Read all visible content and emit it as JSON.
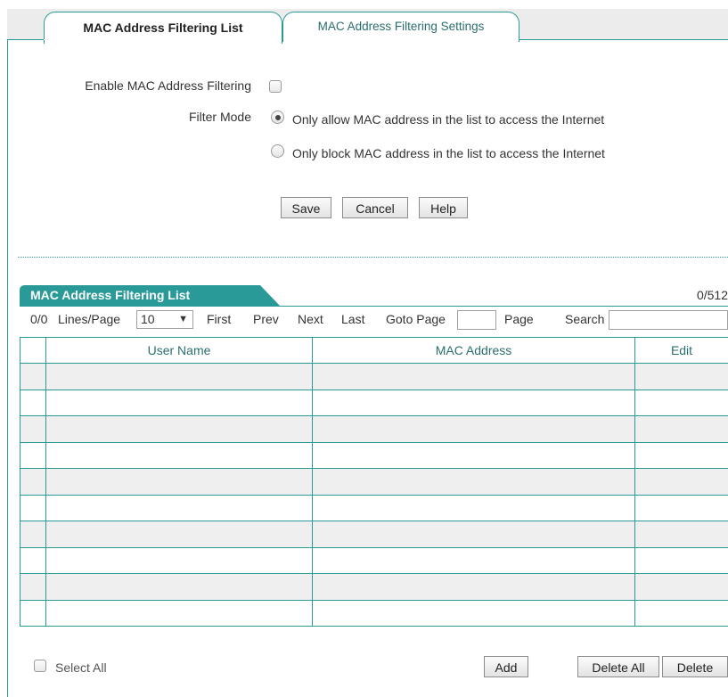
{
  "tabs": {
    "list_tab": "MAC Address Filtering List",
    "settings_tab": "MAC Address Filtering Settings"
  },
  "form": {
    "enable_label": "Enable MAC Address Filtering",
    "enable_checked": false,
    "filter_mode_label": "Filter Mode",
    "mode_allow": "Only allow MAC address in the list to access the Internet",
    "mode_block": "Only block MAC address in the list to access the Internet",
    "selected_mode": "allow"
  },
  "buttons": {
    "save": "Save",
    "cancel": "Cancel",
    "help": "Help",
    "add": "Add",
    "delete_all": "Delete All",
    "delete": "Delete"
  },
  "list": {
    "title": "MAC Address Filtering List",
    "count": "0/512",
    "pager": {
      "records": "0/0",
      "lines_per_page_label": "Lines/Page",
      "lines_per_page_value": "10",
      "first": "First",
      "prev": "Prev",
      "next": "Next",
      "last": "Last",
      "goto_label": "Goto Page",
      "page_label": "Page",
      "search_label": "Search"
    },
    "columns": [
      "",
      "User Name",
      "MAC Address",
      "Edit"
    ],
    "row_count": 10
  },
  "footer": {
    "select_all": "Select All"
  },
  "colors": {
    "accent": "#2a9a99",
    "row_shade": "#efefef"
  }
}
